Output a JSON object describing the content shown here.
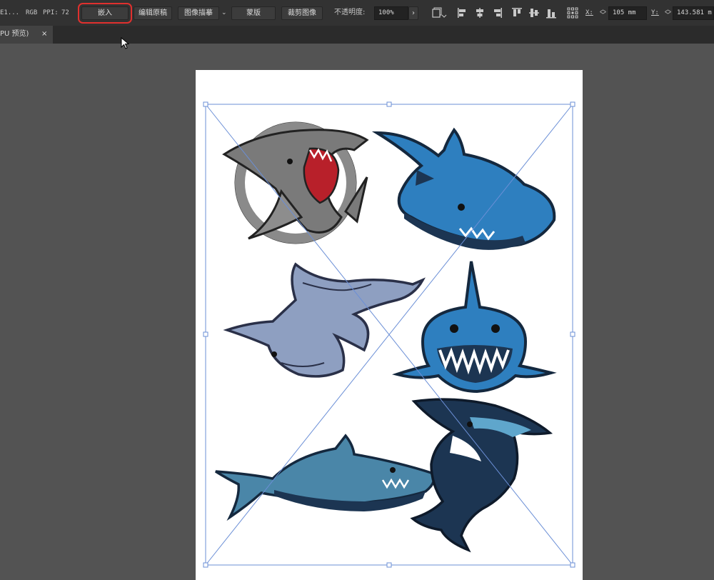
{
  "control_bar": {
    "doc_label": "E1...",
    "color_mode": "RGB",
    "ppi_label": "PPI:",
    "ppi_value": "72",
    "embed_button": "嵌入",
    "edit_original_button": "编辑原稿",
    "image_trace_button": "图像描摹",
    "mask_button": "蒙版",
    "crop_image_button": "裁剪图像",
    "opacity_label": "不透明度:",
    "opacity_value": "100%",
    "x_label": "X:",
    "x_value": "105 mm",
    "y_label": "Y:",
    "y_value": "143.581 m"
  },
  "tab": {
    "label": "PU 预览)",
    "close_glyph": "×"
  },
  "colors": {
    "ui_dark": "#323232",
    "canvas_bg": "#535353",
    "selection": "#6b8fd6",
    "highlight": "#e0302e",
    "shark_gray": "#7a7a7a",
    "shark_blue": "#2e7fbf",
    "shark_navy": "#1c3552",
    "hammerhead": "#8e9fc1",
    "shark_teal": "#4a86a8"
  }
}
